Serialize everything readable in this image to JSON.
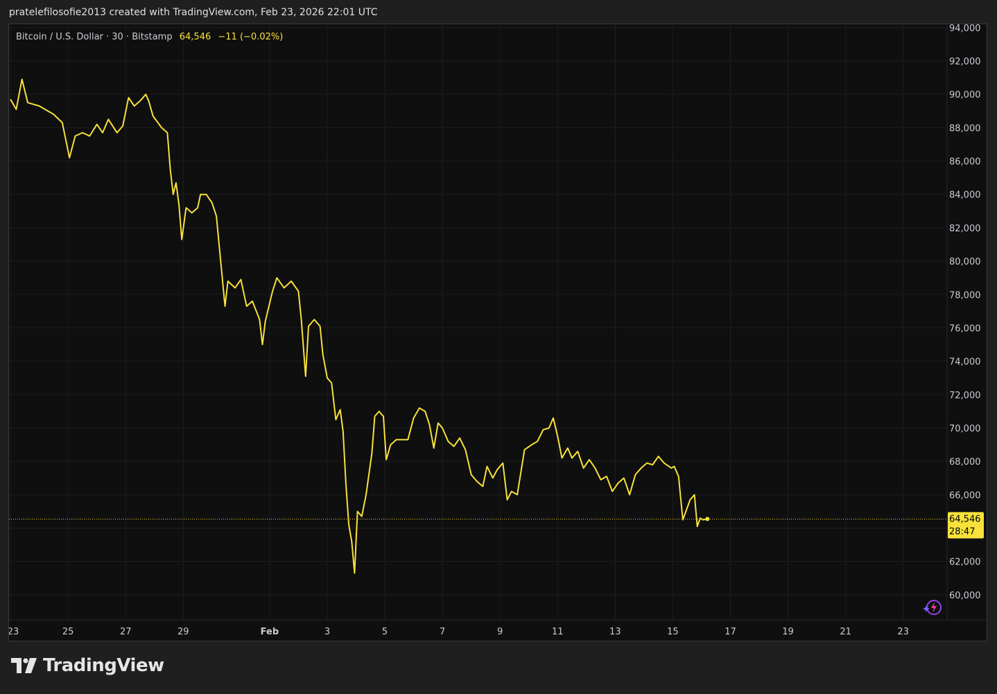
{
  "header": {
    "credit": "pratelefilosofie2013 created with TradingView.com, Feb 23, 2026 22:01 UTC"
  },
  "legend": {
    "symbol": "Bitcoin / U.S. Dollar · 30 · Bitstamp",
    "last_price": "64,546",
    "change": "−11 (−0.02%)"
  },
  "price_tag": {
    "price": "64,546",
    "countdown": "28:47"
  },
  "brand": {
    "name": "TradingView"
  },
  "colors": {
    "line": "#f8e13b",
    "background": "#0f0f0f",
    "grid": "#1e1e1e",
    "axis_text": "#c9ccd4",
    "tag_bg": "#f8e13b"
  },
  "chart_data": {
    "type": "line",
    "ylim": [
      58500,
      94200
    ],
    "y_ticks": [
      94000,
      92000,
      90000,
      88000,
      86000,
      84000,
      82000,
      80000,
      78000,
      76000,
      74000,
      72000,
      70000,
      68000,
      66000,
      64000,
      62000,
      60000
    ],
    "y_tick_labels": [
      "94,000",
      "92,000",
      "90,000",
      "88,000",
      "86,000",
      "84,000",
      "82,000",
      "80,000",
      "78,000",
      "76,000",
      "74,000",
      "72,000",
      "70,000",
      "68,000",
      "66,000",
      "64,000",
      "62,000",
      "60,000"
    ],
    "x_range_days": [
      -9.05,
      23.5
    ],
    "x_ticks": [
      {
        "day": -9,
        "label": "23"
      },
      {
        "day": -7,
        "label": "25"
      },
      {
        "day": -5,
        "label": "27"
      },
      {
        "day": -3,
        "label": "29"
      },
      {
        "day": 0,
        "label": "Feb"
      },
      {
        "day": 2,
        "label": "3"
      },
      {
        "day": 4,
        "label": "5"
      },
      {
        "day": 6,
        "label": "7"
      },
      {
        "day": 8,
        "label": "9"
      },
      {
        "day": 10,
        "label": "11"
      },
      {
        "day": 12,
        "label": "13"
      },
      {
        "day": 14,
        "label": "15"
      },
      {
        "day": 16,
        "label": "17"
      },
      {
        "day": 18,
        "label": "19"
      },
      {
        "day": 20,
        "label": "21"
      },
      {
        "day": 22,
        "label": "23"
      }
    ],
    "series": [
      {
        "points": [
          [
            -9.0,
            89700
          ],
          [
            -8.8,
            89100
          ],
          [
            -8.6,
            90900
          ],
          [
            -8.4,
            89500
          ],
          [
            -8.0,
            89300
          ],
          [
            -7.5,
            88800
          ],
          [
            -7.2,
            88300
          ],
          [
            -6.95,
            86200
          ],
          [
            -6.75,
            87500
          ],
          [
            -6.5,
            87700
          ],
          [
            -6.25,
            87500
          ],
          [
            -6.0,
            88200
          ],
          [
            -5.8,
            87700
          ],
          [
            -5.6,
            88500
          ],
          [
            -5.3,
            87700
          ],
          [
            -5.1,
            88100
          ],
          [
            -4.9,
            89800
          ],
          [
            -4.7,
            89300
          ],
          [
            -4.5,
            89600
          ],
          [
            -4.3,
            90000
          ],
          [
            -4.2,
            89600
          ],
          [
            -4.05,
            88700
          ],
          [
            -3.75,
            88000
          ],
          [
            -3.55,
            87700
          ],
          [
            -3.45,
            85500
          ],
          [
            -3.35,
            84000
          ],
          [
            -3.25,
            84700
          ],
          [
            -3.15,
            83400
          ],
          [
            -3.05,
            81300
          ],
          [
            -2.9,
            83200
          ],
          [
            -2.7,
            82900
          ],
          [
            -2.5,
            83200
          ],
          [
            -2.4,
            84000
          ],
          [
            -2.2,
            84000
          ],
          [
            -2.0,
            83500
          ],
          [
            -1.85,
            82700
          ],
          [
            -1.7,
            80000
          ],
          [
            -1.55,
            77300
          ],
          [
            -1.45,
            78800
          ],
          [
            -1.2,
            78400
          ],
          [
            -1.0,
            78900
          ],
          [
            -0.8,
            77300
          ],
          [
            -0.6,
            77600
          ],
          [
            -0.35,
            76500
          ],
          [
            -0.25,
            75000
          ],
          [
            -0.15,
            76400
          ],
          [
            0.1,
            78200
          ],
          [
            0.25,
            79000
          ],
          [
            0.5,
            78400
          ],
          [
            0.75,
            78800
          ],
          [
            1.0,
            78200
          ],
          [
            1.1,
            76500
          ],
          [
            1.25,
            73100
          ],
          [
            1.35,
            76100
          ],
          [
            1.55,
            76500
          ],
          [
            1.75,
            76100
          ],
          [
            1.85,
            74400
          ],
          [
            2.0,
            73000
          ],
          [
            2.15,
            72700
          ],
          [
            2.3,
            70500
          ],
          [
            2.45,
            71100
          ],
          [
            2.55,
            69800
          ],
          [
            2.65,
            66600
          ],
          [
            2.75,
            64200
          ],
          [
            2.85,
            63200
          ],
          [
            2.95,
            61300
          ],
          [
            3.05,
            65000
          ],
          [
            3.2,
            64700
          ],
          [
            3.35,
            66000
          ],
          [
            3.55,
            68500
          ],
          [
            3.65,
            70700
          ],
          [
            3.8,
            71000
          ],
          [
            3.95,
            70700
          ],
          [
            4.05,
            68100
          ],
          [
            4.2,
            69000
          ],
          [
            4.4,
            69300
          ],
          [
            4.6,
            69300
          ],
          [
            4.8,
            69300
          ],
          [
            5.0,
            70600
          ],
          [
            5.2,
            71200
          ],
          [
            5.4,
            71000
          ],
          [
            5.55,
            70200
          ],
          [
            5.7,
            68800
          ],
          [
            5.85,
            70300
          ],
          [
            6.0,
            70000
          ],
          [
            6.2,
            69200
          ],
          [
            6.4,
            68900
          ],
          [
            6.6,
            69400
          ],
          [
            6.8,
            68700
          ],
          [
            7.0,
            67200
          ],
          [
            7.2,
            66800
          ],
          [
            7.4,
            66500
          ],
          [
            7.55,
            67700
          ],
          [
            7.75,
            67000
          ],
          [
            7.9,
            67500
          ],
          [
            8.1,
            67900
          ],
          [
            8.25,
            65700
          ],
          [
            8.4,
            66200
          ],
          [
            8.6,
            66000
          ],
          [
            8.85,
            68700
          ],
          [
            9.1,
            69000
          ],
          [
            9.3,
            69200
          ],
          [
            9.5,
            69900
          ],
          [
            9.7,
            70000
          ],
          [
            9.85,
            70600
          ],
          [
            10.0,
            69500
          ],
          [
            10.15,
            68200
          ],
          [
            10.35,
            68800
          ],
          [
            10.5,
            68200
          ],
          [
            10.7,
            68600
          ],
          [
            10.9,
            67600
          ],
          [
            11.1,
            68100
          ],
          [
            11.3,
            67600
          ],
          [
            11.5,
            66900
          ],
          [
            11.7,
            67100
          ],
          [
            11.9,
            66200
          ],
          [
            12.1,
            66700
          ],
          [
            12.3,
            67000
          ],
          [
            12.5,
            66000
          ],
          [
            12.7,
            67200
          ],
          [
            12.9,
            67600
          ],
          [
            13.1,
            67900
          ],
          [
            13.3,
            67800
          ],
          [
            13.5,
            68300
          ],
          [
            13.7,
            67900
          ],
          [
            13.95,
            67600
          ],
          [
            14.05,
            67700
          ],
          [
            14.2,
            67100
          ],
          [
            14.35,
            64500
          ],
          [
            14.6,
            65700
          ],
          [
            14.75,
            66000
          ],
          [
            14.85,
            64100
          ],
          [
            14.95,
            64600
          ],
          [
            15.05,
            64500
          ],
          [
            15.2,
            64550
          ]
        ]
      }
    ],
    "last_price_y": 64546
  }
}
